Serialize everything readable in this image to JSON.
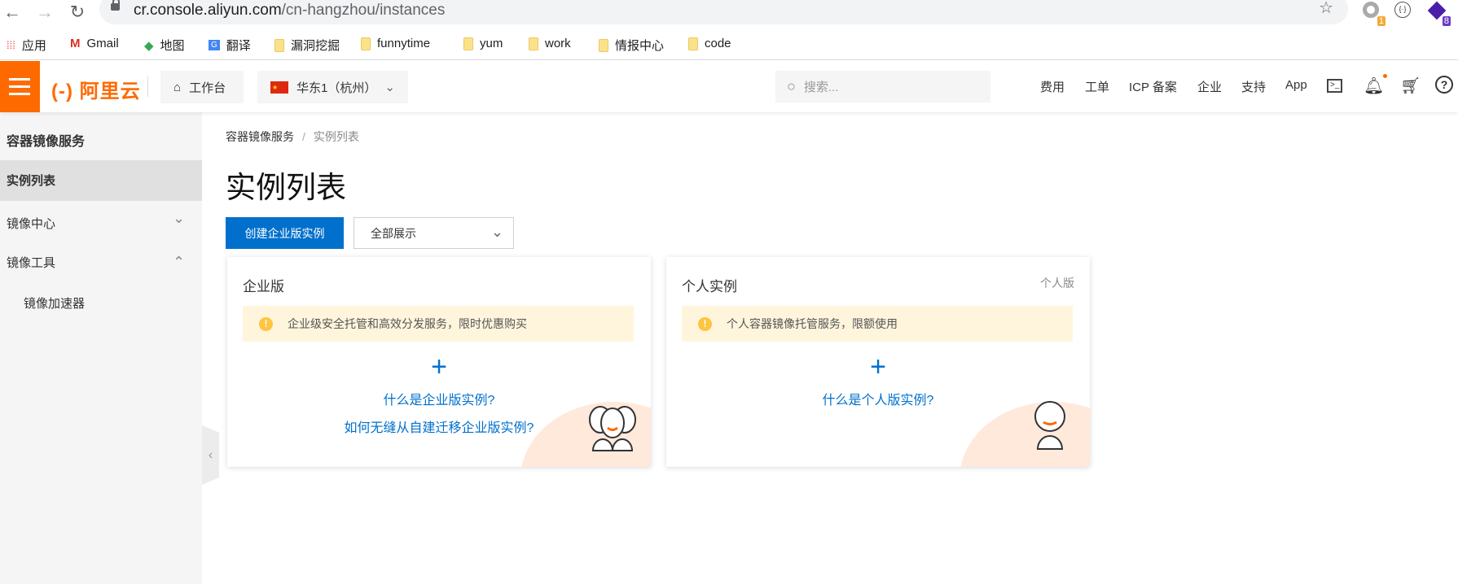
{
  "browser": {
    "url_host": "cr.console.aliyun.com",
    "url_path": "/cn-hangzhou/instances",
    "extensions": [
      {
        "name": "ext-1",
        "badge": "1",
        "color": "#f2a93b"
      },
      {
        "name": "ext-json",
        "badge": ""
      },
      {
        "name": "ext-8",
        "badge": "8",
        "color": "#6a3bc9"
      }
    ]
  },
  "bookmarks": [
    "应用",
    "Gmail",
    "地图",
    "翻译",
    "漏洞挖掘",
    "funnytime",
    "yum",
    "work",
    "情报中心",
    "code"
  ],
  "header": {
    "logo": "(-) 阿里云",
    "workbench": "工作台",
    "region": "华东1（杭州）",
    "search_placeholder": "搜索...",
    "nav": [
      "费用",
      "工单",
      "ICP 备案",
      "企业",
      "支持",
      "App"
    ],
    "accent": "#ff6a00"
  },
  "sidebar": {
    "title": "容器镜像服务",
    "items": [
      {
        "label": "实例列表",
        "active": true
      },
      {
        "label": "镜像中心",
        "chevron": "down"
      },
      {
        "label": "镜像工具",
        "chevron": "up"
      },
      {
        "label": "镜像加速器",
        "sub": true
      }
    ]
  },
  "main": {
    "breadcrumb": [
      "容器镜像服务",
      "实例列表"
    ],
    "title": "实例列表",
    "create_button": "创建企业版实例",
    "filter": "全部展示",
    "cards": [
      {
        "title": "企业版",
        "tag": "",
        "alert": "企业级安全托管和高效分发服务，限时优惠购买",
        "links": [
          "什么是企业版实例?",
          "如何无缝从自建迁移企业版实例?"
        ]
      },
      {
        "title": "个人实例",
        "tag": "个人版",
        "alert": "个人容器镜像托管服务，限额使用",
        "links": [
          "什么是个人版实例?"
        ]
      }
    ]
  },
  "primary_color": "#0070cc"
}
